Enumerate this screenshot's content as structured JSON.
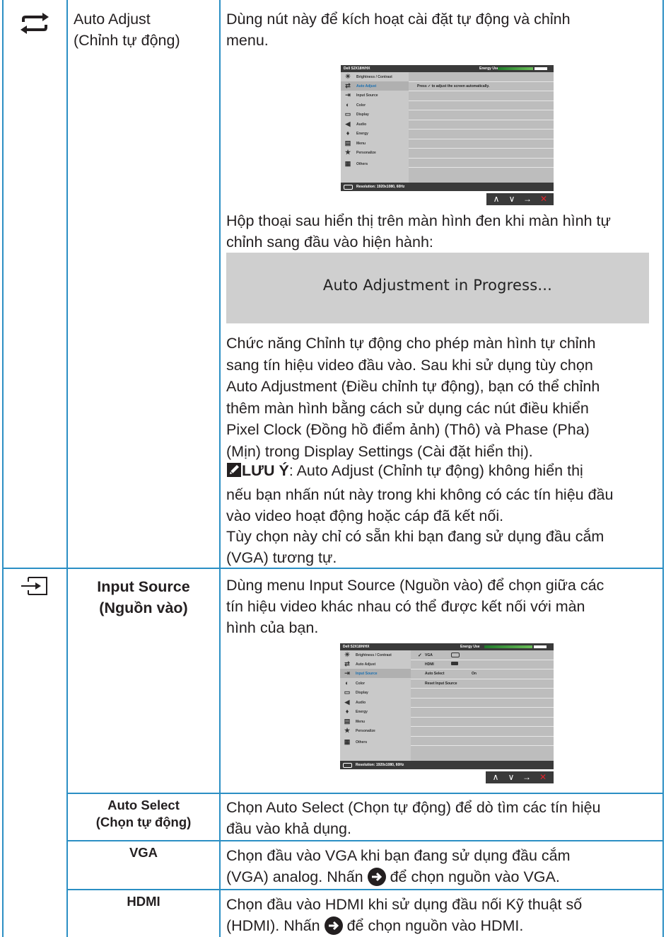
{
  "auto_adjust": {
    "name_line1": "Auto Adjust",
    "name_line2": "(Chỉnh tự động)",
    "desc_line1": "Dùng nút này để kích hoạt cài đặt tự động và chỉnh",
    "desc_line2": "menu.",
    "dialog_intro_line1": "Hộp thoại sau hiển thị trên màn hình đen khi màn hình tự",
    "dialog_intro_line2": "chỉnh sang đầu vào hiện hành:",
    "progress_text": "Auto Adjustment in Progress...",
    "para_lines": [
      "Chức năng Chỉnh tự động cho phép màn hình tự chỉnh",
      "sang tín hiệu video đầu vào. Sau khi sử dụng tùy chọn",
      "Auto Adjustment (Điều chỉnh tự động), bạn có thể chỉnh",
      "thêm màn hình bằng cách sử dụng các nút điều khiển",
      "Pixel Clock (Đồng hồ điểm ảnh) (Thô) và Phase (Pha)",
      "(Mịn) trong Display Settings (Cài đặt hiển thị)."
    ],
    "note_label": "LƯU Ý",
    "note_line1_rest": ": Auto Adjust (Chỉnh tự động) không hiển thị",
    "note_line2": "nếu bạn nhấn nút này trong khi không có các tín hiệu đầu",
    "note_line3": "vào video hoạt động hoặc cáp đã kết nối.",
    "vga_line1": "Tùy chọn này chỉ có sẵn khi bạn đang sử dụng đầu cắm",
    "vga_line2": "(VGA) tương tự."
  },
  "osd": {
    "model": "Dell S2X18H/HX",
    "energy_use": "Energy Use",
    "menu_items": [
      "Brightness / Contrast",
      "Auto Adjust",
      "Input Source",
      "Color",
      "Display",
      "Audio",
      "Energy",
      "Menu",
      "Personalize",
      "Others"
    ],
    "menu_icons": [
      "sun-icon",
      "arrows-icon",
      "input-icon",
      "color-icon",
      "display-icon",
      "audio-icon",
      "energy-icon",
      "menu-icon",
      "star-icon",
      "others-icon"
    ],
    "resolution": "Resolution: 1920x1080, 60Hz",
    "auto_adjust_hint": "Press ✓ to adjust the screen automatically.",
    "input_options": [
      "VGA",
      "HDMI",
      "Auto Select",
      "Reset Input Source"
    ],
    "auto_select_value": "On",
    "nav_buttons": [
      "∧",
      "∨",
      "→",
      "✕"
    ]
  },
  "input_source": {
    "name_line1": "Input Source",
    "name_line2": "(Nguồn vào)",
    "desc_line1": "Dùng menu Input Source (Nguồn vào) để chọn giữa các",
    "desc_line2": "tín hiệu video khác nhau có thể được kết nối với màn",
    "desc_line3": "hình của bạn."
  },
  "auto_select": {
    "name_line1": "Auto Select",
    "name_line2": "(Chọn tự động)",
    "desc_line1": "Chọn Auto Select (Chọn tự động) để dò tìm các tín hiệu",
    "desc_line2": "đầu vào khả dụng."
  },
  "vga": {
    "name": "VGA",
    "desc_line1": "Chọn đầu vào VGA khi bạn đang sử dụng đầu cắm",
    "desc_line2a": "(VGA) analog. Nhấn",
    "desc_line2b": "để chọn nguồn vào VGA."
  },
  "hdmi": {
    "name": "HDMI",
    "desc_line1": "Chọn đầu vào HDMI khi sử dụng đầu nối Kỹ thuật số",
    "desc_line2a": "(HDMI). Nhấn",
    "desc_line2b": "để chọn nguồn vào HDMI."
  }
}
